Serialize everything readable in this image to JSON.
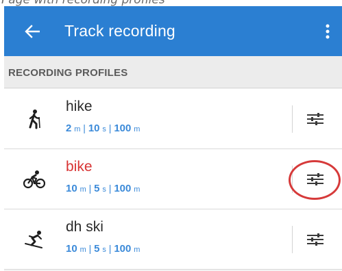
{
  "caption": {
    "text": "Page with recording profiles"
  },
  "appbar": {
    "title": "Track recording",
    "back_icon": "arrow-left-icon",
    "menu_icon": "more-vert-icon",
    "color": "#2b7fd2"
  },
  "section": {
    "title": "RECORDING PROFILES"
  },
  "profiles": [
    {
      "name": "hike",
      "icon": "hiking-icon",
      "distance": "2",
      "distance_unit": "m",
      "time": "10",
      "time_unit": "s",
      "accuracy": "100",
      "accuracy_unit": "m",
      "active": false
    },
    {
      "name": "bike",
      "icon": "cycling-icon",
      "distance": "10",
      "distance_unit": "m",
      "time": "5",
      "time_unit": "s",
      "accuracy": "100",
      "accuracy_unit": "m",
      "active": true
    },
    {
      "name": "dh ski",
      "icon": "skiing-icon",
      "distance": "10",
      "distance_unit": "m",
      "time": "5",
      "time_unit": "s",
      "accuracy": "100",
      "accuracy_unit": "m",
      "active": false
    }
  ],
  "separator": "|",
  "colors": {
    "accent": "#2b7fd2",
    "active_name": "#d83333",
    "params": "#3b8ad9",
    "highlight": "#d63a3a"
  }
}
